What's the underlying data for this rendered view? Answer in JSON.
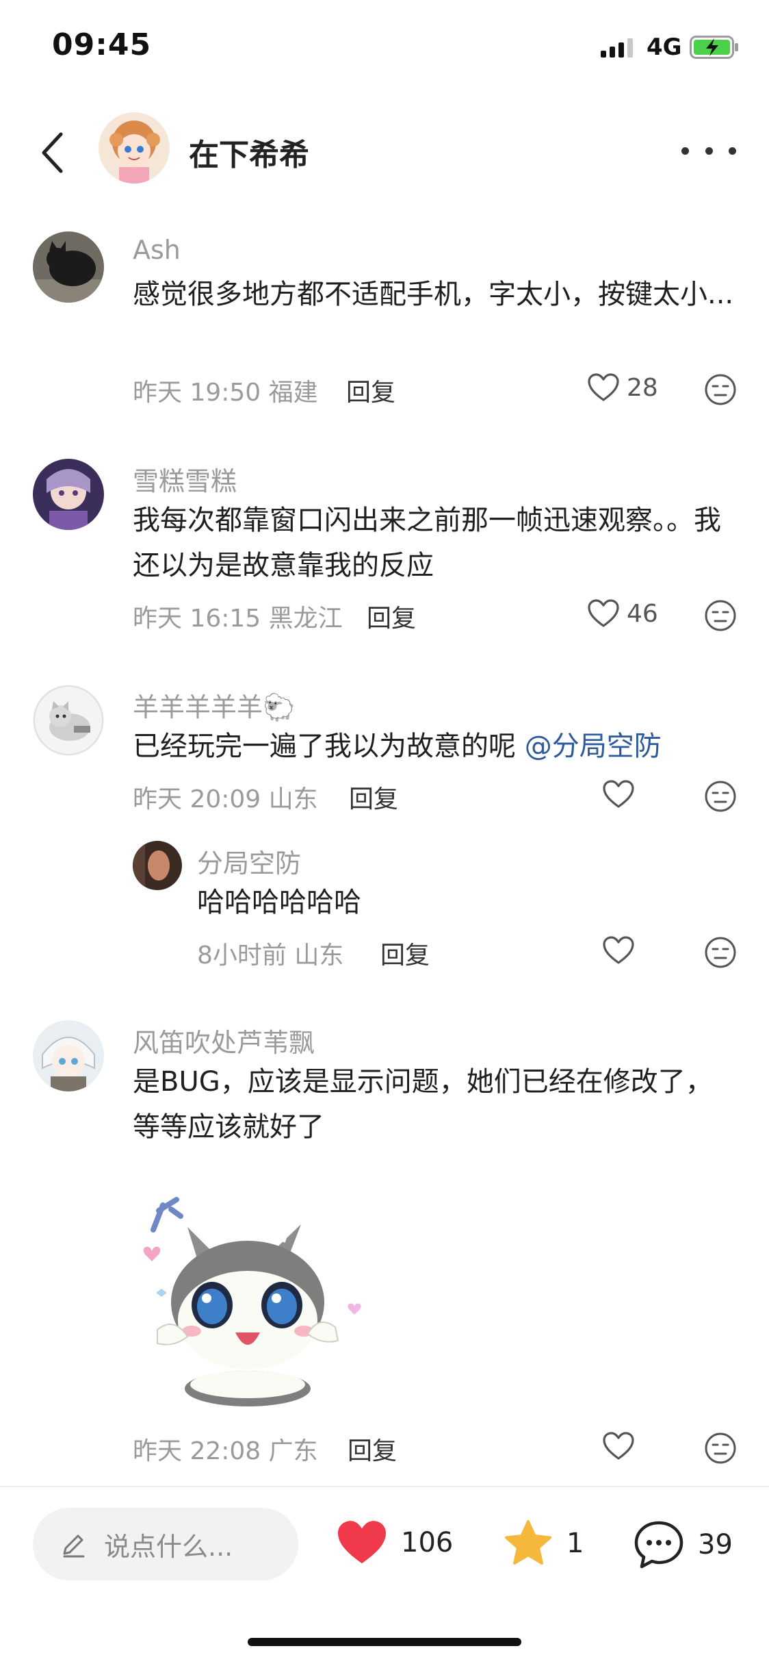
{
  "status_bar": {
    "time": "09:45",
    "network": "4G"
  },
  "header": {
    "title": "在下希希"
  },
  "comments": [
    {
      "author": "Ash",
      "text": "感觉很多地方都不适配手机，字太小，按键太小...",
      "time": "昨天 19:50",
      "location": "福建",
      "reply_label": "回复",
      "likes": "28"
    },
    {
      "author": "雪糕雪糕",
      "text": "我每次都靠窗口闪出来之前那一帧迅速观察。。我还以为是故意靠我的反应",
      "time": "昨天 16:15",
      "location": "黑龙江",
      "reply_label": "回复",
      "likes": "46"
    },
    {
      "author": "羊羊羊羊羊",
      "author_emoji": "🐑",
      "text": "已经玩完一遍了我以为故意的呢 ",
      "mention": "@分局空防",
      "time": "昨天 20:09",
      "location": "山东",
      "reply_label": "回复",
      "likes": ""
    },
    {
      "author": "分局空防",
      "text": "哈哈哈哈哈哈",
      "time": "8小时前",
      "location": "山东",
      "reply_label": "回复",
      "likes": ""
    },
    {
      "author": "风笛吹处芦苇飘",
      "text": "是BUG，应该是显示问题，她们已经在修改了，等等应该就好了",
      "time": "昨天 22:08",
      "location": "广东",
      "reply_label": "回复",
      "likes": ""
    }
  ],
  "bottom_bar": {
    "input_placeholder": "说点什么...",
    "like_count": "106",
    "favorite_count": "1",
    "comment_count": "39"
  },
  "colors": {
    "like_red": "#f03a4b",
    "favorite_yellow": "#f5b83d",
    "mention_blue": "#2c5a9a",
    "meta_gray": "#9a9a9a"
  }
}
